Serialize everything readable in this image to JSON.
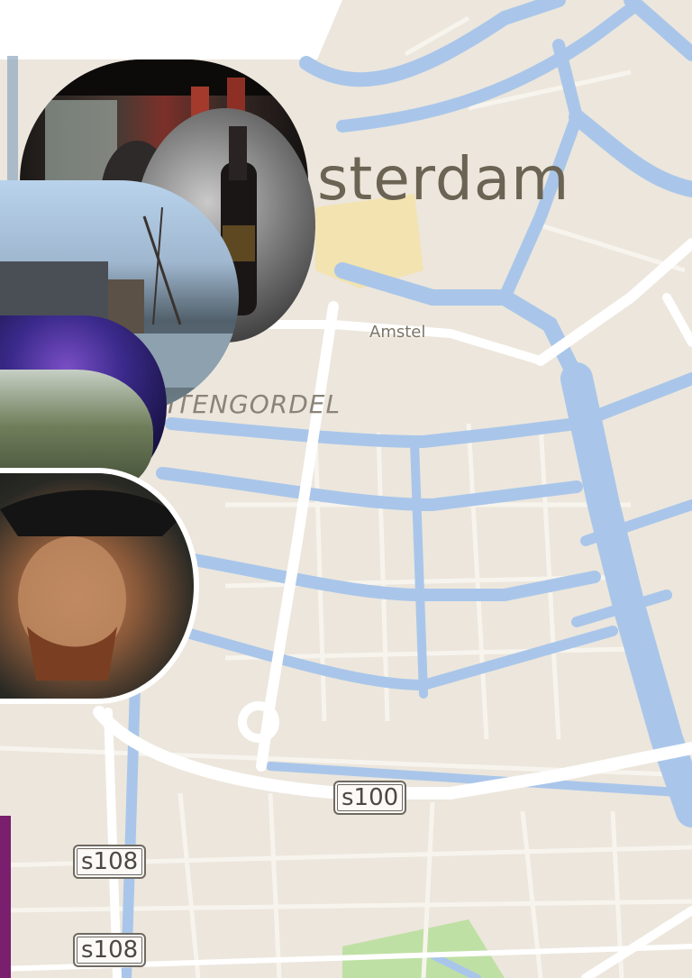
{
  "map": {
    "city_label": "sterdam",
    "river_label": "Amstel",
    "district_label": "ITENGORDEL",
    "road_shields": [
      "s100",
      "s108",
      "s108"
    ]
  },
  "photos": [
    {
      "name": "photo-cafe-interior"
    },
    {
      "name": "photo-wine-bottle"
    },
    {
      "name": "photo-canal-winter"
    },
    {
      "name": "photo-concert-lights"
    },
    {
      "name": "photo-tree-street"
    },
    {
      "name": "photo-portrait-painting"
    }
  ],
  "colors": {
    "land": "#ece6dc",
    "water": "#a9c6ea",
    "road": "#ffffff",
    "park": "#bfe0a4",
    "yellow_area": "#f2e3b0",
    "accent_purple": "#7a1e6e"
  }
}
